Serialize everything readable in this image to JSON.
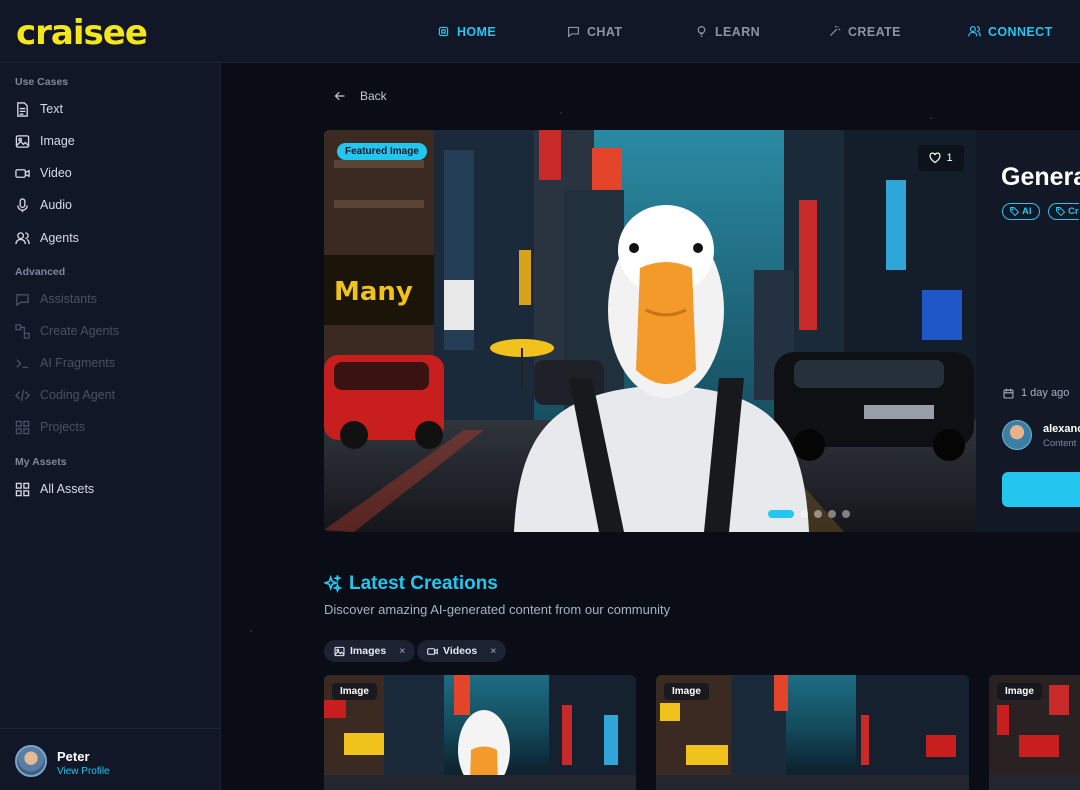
{
  "brand": {
    "logo_text": "CRAISEE",
    "accent": "#24c6ef",
    "logo_color": "#f5e61c"
  },
  "nav": {
    "home": "HOME",
    "chat": "CHAT",
    "learn": "LEARN",
    "create": "CREATE",
    "connect": "CONNECT",
    "active": "home"
  },
  "sidebar": {
    "use_cases_label": "Use Cases",
    "use_cases": [
      {
        "label": "Text",
        "icon": "document-icon"
      },
      {
        "label": "Image",
        "icon": "image-icon"
      },
      {
        "label": "Video",
        "icon": "video-camera-icon"
      },
      {
        "label": "Audio",
        "icon": "microphone-icon"
      },
      {
        "label": "Agents",
        "icon": "users-icon"
      }
    ],
    "advanced_label": "Advanced",
    "advanced": [
      {
        "label": "Assistants",
        "icon": "chat-bubble-icon",
        "disabled": true
      },
      {
        "label": "Create Agents",
        "icon": "nodes-icon",
        "disabled": true
      },
      {
        "label": "AI Fragments",
        "icon": "terminal-icon",
        "disabled": true
      },
      {
        "label": "Coding Agent",
        "icon": "code-icon",
        "disabled": true
      },
      {
        "label": "Projects",
        "icon": "grid-icon",
        "disabled": true
      }
    ],
    "my_assets_label": "My Assets",
    "my_assets": [
      {
        "label": "All Assets",
        "icon": "grid-icon"
      }
    ]
  },
  "profile": {
    "name": "Peter",
    "link": "View Profile"
  },
  "back_label": "Back",
  "featured": {
    "badge": "Featured Image",
    "likes": "1",
    "title": "Genera",
    "tags": [
      "AI",
      "Cr"
    ],
    "time_ago": "1 day ago",
    "author": "alexanc",
    "author_sub": "Content",
    "slide_count": 6,
    "active_slide": 0
  },
  "latest": {
    "title": "Latest Creations",
    "subtitle": "Discover amazing AI-generated content from our community",
    "filters": [
      {
        "label": "Images",
        "icon": "image-icon"
      },
      {
        "label": "Videos",
        "icon": "video-camera-icon"
      }
    ],
    "filter_remove": "×",
    "cards": [
      {
        "label": "Image"
      },
      {
        "label": "Image"
      },
      {
        "label": "Image"
      }
    ]
  }
}
